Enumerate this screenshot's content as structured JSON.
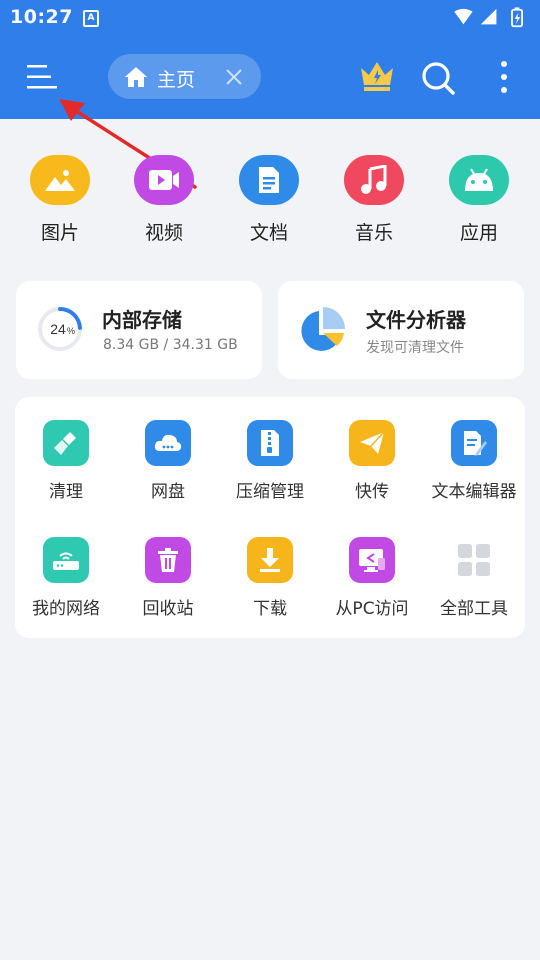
{
  "status": {
    "time": "10:27",
    "notif": "A"
  },
  "toolbar": {
    "tab_label": "主页"
  },
  "categories": [
    {
      "label": "图片",
      "color": "#f8b91d"
    },
    {
      "label": "视频",
      "color": "#c04ae3"
    },
    {
      "label": "文档",
      "color": "#2f8ae8"
    },
    {
      "label": "音乐",
      "color": "#f0495f"
    },
    {
      "label": "应用",
      "color": "#2ec9ad"
    }
  ],
  "storage": {
    "title": "内部存储",
    "usage": "8.34 GB / 34.31 GB",
    "percent_label": "24",
    "percent_sign": "%",
    "percent": 24
  },
  "analyzer": {
    "title": "文件分析器",
    "subtitle": "发现可清理文件"
  },
  "tools": [
    {
      "label": "清理",
      "icon": "broom-icon",
      "color": "#2ec9b0"
    },
    {
      "label": "网盘",
      "icon": "cloud-icon",
      "color": "#2f8ae8"
    },
    {
      "label": "压缩管理",
      "icon": "zip-icon",
      "color": "#2f8ae8"
    },
    {
      "label": "快传",
      "icon": "paper-plane-icon",
      "color": "#f7b51c"
    },
    {
      "label": "文本编辑器",
      "icon": "text-edit-icon",
      "color": "#2f8ae8"
    },
    {
      "label": "我的网络",
      "icon": "router-icon",
      "color": "#2ec9b0"
    },
    {
      "label": "回收站",
      "icon": "trash-icon",
      "color": "#c04ae3"
    },
    {
      "label": "下载",
      "icon": "download-icon",
      "color": "#f7b51c"
    },
    {
      "label": "从PC访问",
      "icon": "pc-access-icon",
      "color": "#c04ae3"
    },
    {
      "label": "全部工具",
      "icon": "grid-icon",
      "color": "#d5d7dc"
    }
  ]
}
